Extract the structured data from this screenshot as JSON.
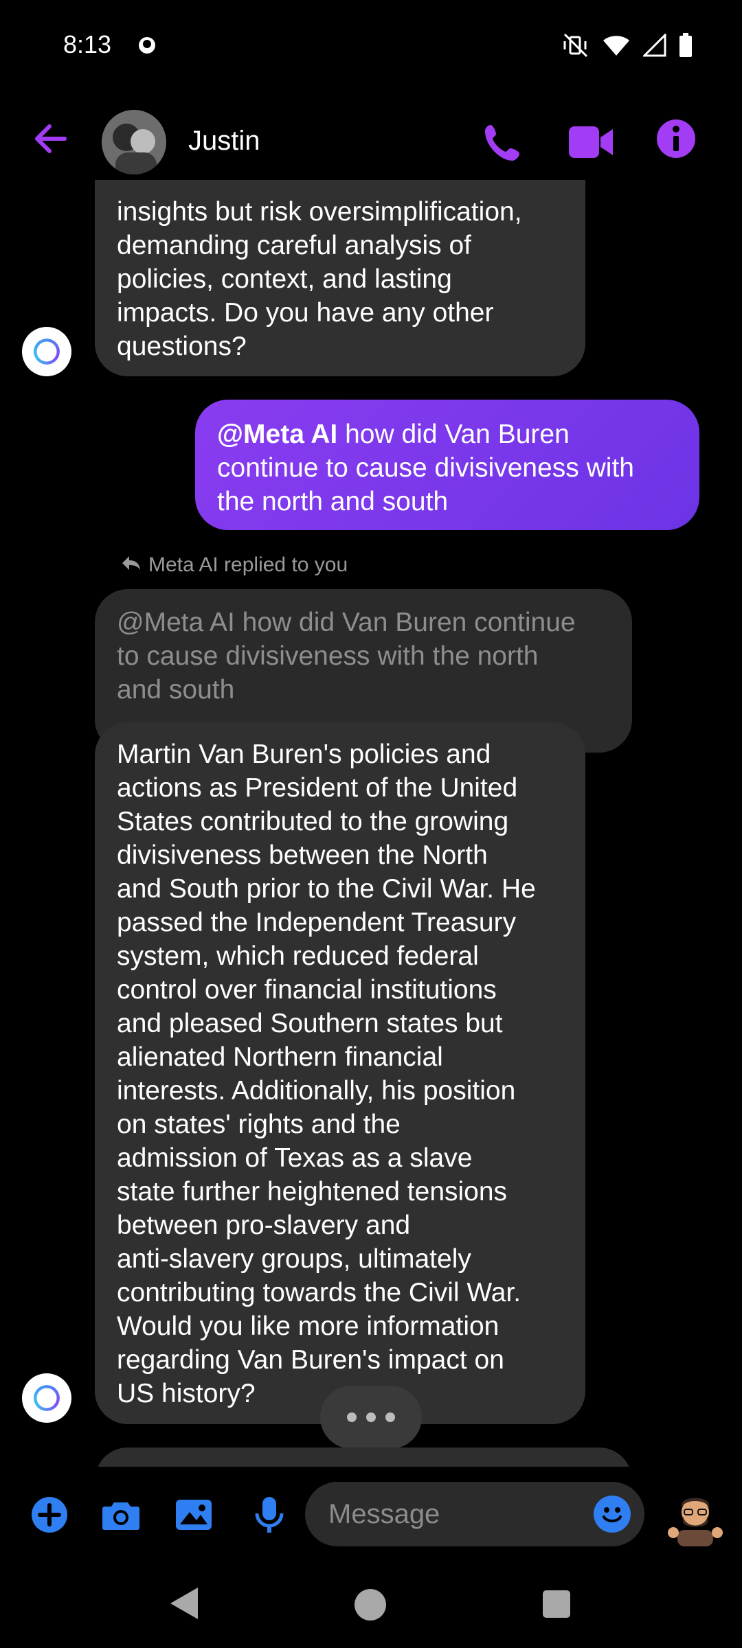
{
  "status_bar": {
    "time": "8:13"
  },
  "header": {
    "contact_name": "Justin",
    "accent": "#a33cf5"
  },
  "messages": {
    "ai_bubble_1": "insights but risk oversimplification,\ndemanding careful analysis of\npolicies, context, and lasting\nimpacts. Do you have any other\nquestions?",
    "user_mention": "@Meta AI",
    "user_text": " how did Van Buren\ncontinue to cause divisiveness with\nthe north and south",
    "reply_label": "Meta AI replied to you",
    "quoted_text": "@Meta AI how did Van Buren continue\nto cause divisiveness with the north\nand south",
    "ai_bubble_2": "Martin Van Buren's policies and\nactions as President of the United\nStates contributed to the growing\ndivisiveness between the North\nand South prior to the Civil War. He\npassed the Independent Treasury\nsystem, which reduced federal\ncontrol over financial institutions\nand pleased Southern states but\nalienated Northern financial\ninterests. Additionally, his position\non states' rights and the\nadmission of Texas as a slave\nstate further heightened tensions\nbetween pro-slavery and\nanti-slavery groups, ultimately\ncontributing towards the Civil War.\nWould you like more information\nregarding Van Buren's impact on\nUS history?"
  },
  "composer": {
    "placeholder": "Message",
    "icon_color": "#2f7ff2"
  }
}
